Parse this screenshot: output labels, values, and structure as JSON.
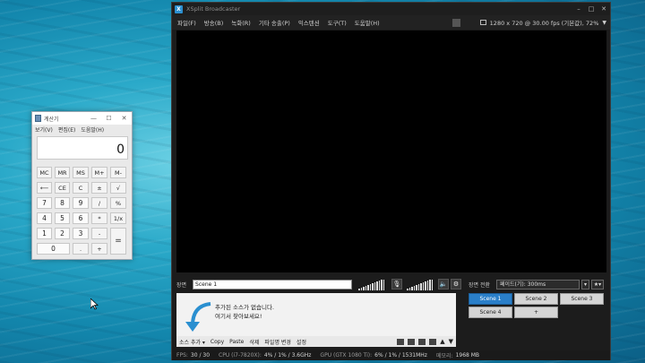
{
  "calculator": {
    "title": "계산기",
    "menu": [
      "보기(V)",
      "편집(E)",
      "도움말(H)"
    ],
    "display": "0",
    "memory_buttons": [
      "MC",
      "MR",
      "MS",
      "M+",
      "M-"
    ],
    "rows": [
      [
        "⟵",
        "CE",
        "C",
        "±",
        "√"
      ],
      [
        "7",
        "8",
        "9",
        "/",
        "%"
      ],
      [
        "4",
        "5",
        "6",
        "*",
        "1/x"
      ],
      [
        "1",
        "2",
        "3",
        "-",
        ""
      ],
      [
        "0",
        ".",
        "+"
      ]
    ],
    "equals": "="
  },
  "xsplit": {
    "title": "XSplit Broadcaster",
    "menu": [
      "파일(F)",
      "방송(B)",
      "녹화(R)",
      "기타 송출(P)",
      "익스텐션",
      "도구(T)",
      "도움말(H)"
    ],
    "resolution": "1280 x 720 @ 30.00 fps (기본값), 72%",
    "scene_label": "장면",
    "scene_name": "Scene 1",
    "sources_hint_line1": "추가된 소스가 없습니다.",
    "sources_hint_line2": "여기서 찾아보세요!",
    "source_toolbar": [
      "소스 추가 ▾",
      "Copy",
      "Paste",
      "삭제",
      "파일명 변경",
      "설정"
    ],
    "transition_label": "장면 전환",
    "transition_value": "페이드(기): 300ms",
    "scenes": [
      "Scene 1",
      "Scene 2",
      "Scene 3",
      "Scene 4",
      "+"
    ],
    "status": {
      "fps_label": "FPS:",
      "fps_value": "30 / 30",
      "cpu_label": "CPU (i7-7820X):",
      "cpu_value": "4% / 1% / 3.6GHz",
      "gpu_label": "GPU (GTX 1080 Ti):",
      "gpu_value": "6% / 1% / 1531MHz",
      "mem_label": "메모리:",
      "mem_value": "1968 MB"
    }
  }
}
